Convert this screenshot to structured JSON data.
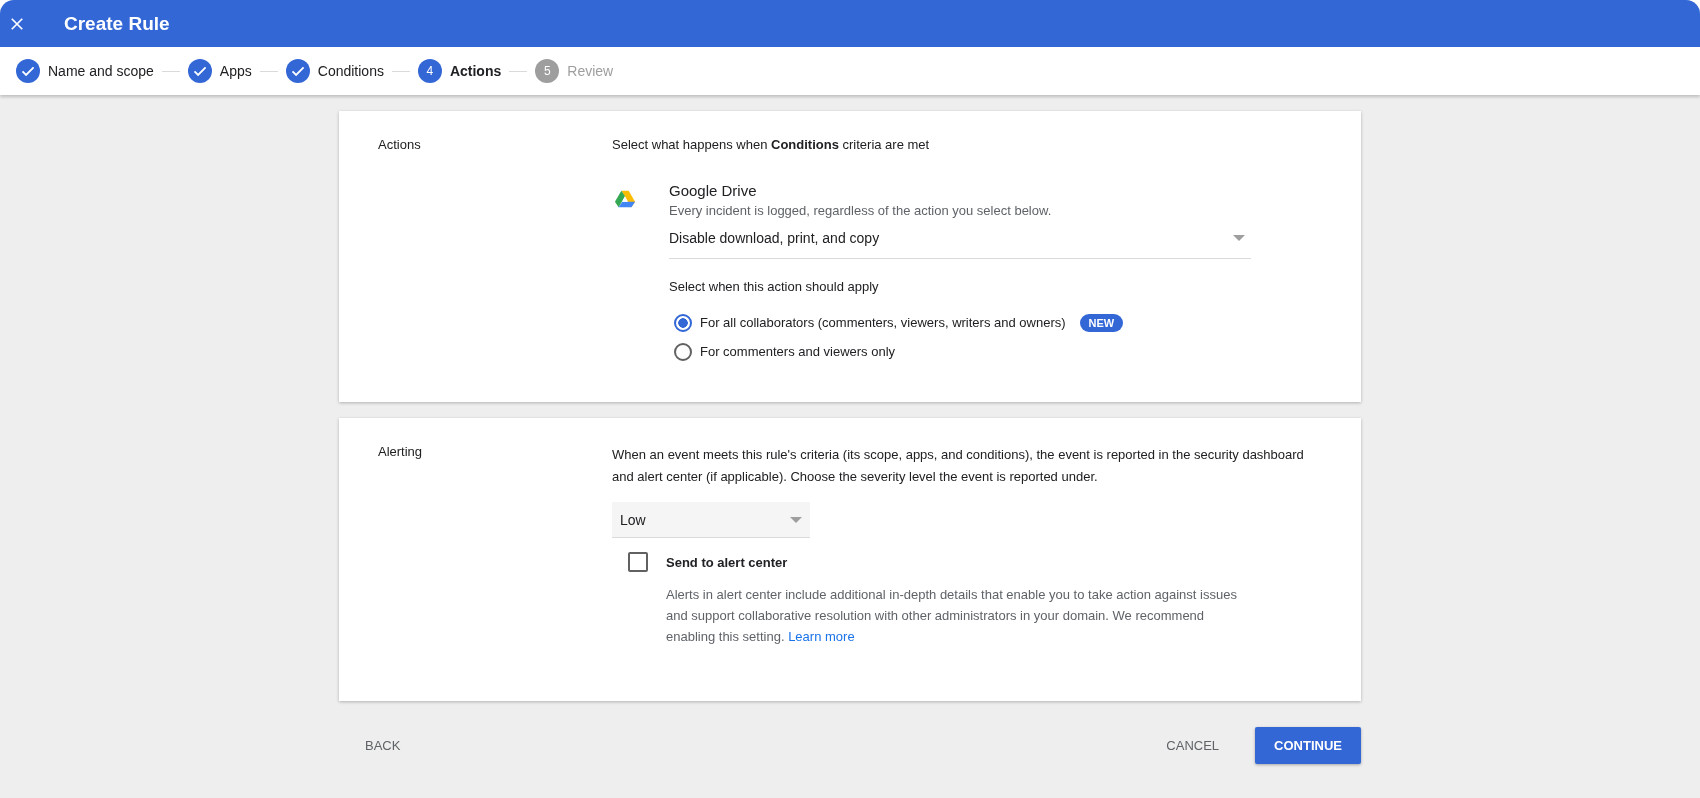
{
  "window": {
    "title": "Create Rule"
  },
  "steps": [
    {
      "label": "Name and scope",
      "kind": "done"
    },
    {
      "label": "Apps",
      "kind": "done"
    },
    {
      "label": "Conditions",
      "kind": "done"
    },
    {
      "number": "4",
      "label": "Actions",
      "kind": "current"
    },
    {
      "number": "5",
      "label": "Review",
      "kind": "upcoming"
    }
  ],
  "actions": {
    "label": "Actions",
    "intro": "Select what happens when **Conditions** criteria are met",
    "app": {
      "name": "Google Drive",
      "note": "Every incident is logged, regardless of the action you select below."
    },
    "action_select": {
      "value": "Disable download, print, and copy"
    },
    "apply_heading": "Select when this action should apply",
    "options": [
      {
        "label": "For all collaborators (commenters, viewers, writers and owners)",
        "badge": "NEW",
        "selected": true
      },
      {
        "label": "For commenters and viewers only",
        "selected": false
      }
    ]
  },
  "alerting": {
    "label": "Alerting",
    "description": "When an event meets this rule's criteria (its scope, apps, and conditions), the event is reported in the security dashboard and alert center (if applicable). Choose the severity level the event is reported under.",
    "severity_select": {
      "value": "Low"
    },
    "alert_center": {
      "label": "Send to alert center",
      "checked": false,
      "description": "Alerts in alert center include additional in-depth details that enable you to take action against issues and support collaborative resolution with other administrators in your domain. We recommend enabling this setting.",
      "link": "Learn more"
    }
  },
  "footer": {
    "back": "BACK",
    "cancel": "CANCEL",
    "continue": "CONTINUE"
  }
}
